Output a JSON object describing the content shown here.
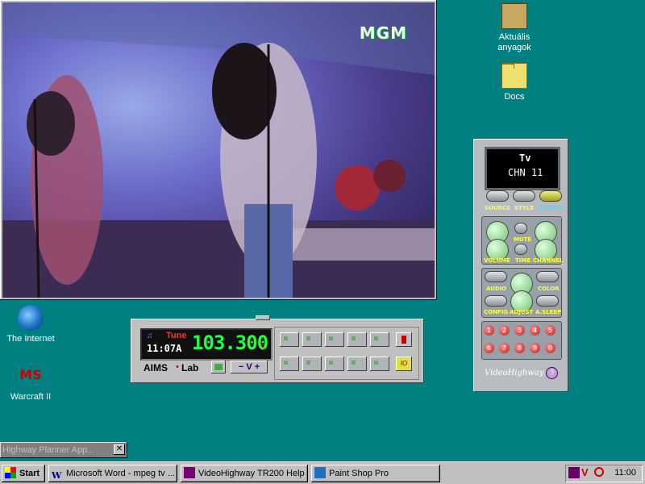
{
  "video_window": {
    "overlay_logo": "MGM"
  },
  "desktop_icons": [
    {
      "label": "Aktuális\nanyagok"
    },
    {
      "label": "Docs"
    },
    {
      "label": "The Internet"
    },
    {
      "label": "Warcraft II"
    }
  ],
  "tv_remote": {
    "display_line1": "Tv",
    "display_line2": "CHN 11",
    "labels": {
      "source": "SOURCE",
      "style": "STYLE",
      "power": "POWER",
      "mute": "MUTE",
      "volume": "VOLUME",
      "time": "TIME",
      "channel": "CHANNEL",
      "audio": "AUDIO",
      "color": "COLOR",
      "config": "CONFIG",
      "adjust": "ADJUST",
      "a_sleep": "A.SLEEP",
      "brand": "VideoHighway"
    },
    "numbers": [
      "1",
      "2",
      "3",
      "4",
      "5",
      "6",
      "7",
      "8",
      "9",
      "0"
    ]
  },
  "radio_panel": {
    "tune_label": "Tune",
    "time": "11:07A",
    "frequency": "103.300",
    "channel": "3",
    "brand": "AIMS",
    "brand2": "Lab",
    "volume_label": "V"
  },
  "minimized_window": {
    "title": "Highway Planner App..."
  },
  "taskbar": {
    "start_label": "Start",
    "tasks": [
      {
        "label": "Microsoft Word - mpeg tv ..."
      },
      {
        "label": "VideoHighway TR200 Help"
      },
      {
        "label": "Paint Shop Pro"
      }
    ],
    "clock": "11:00"
  },
  "colors": {
    "desktop": "#008080",
    "lcd_green": "#20ff40",
    "tune_red": "#ff3030"
  }
}
